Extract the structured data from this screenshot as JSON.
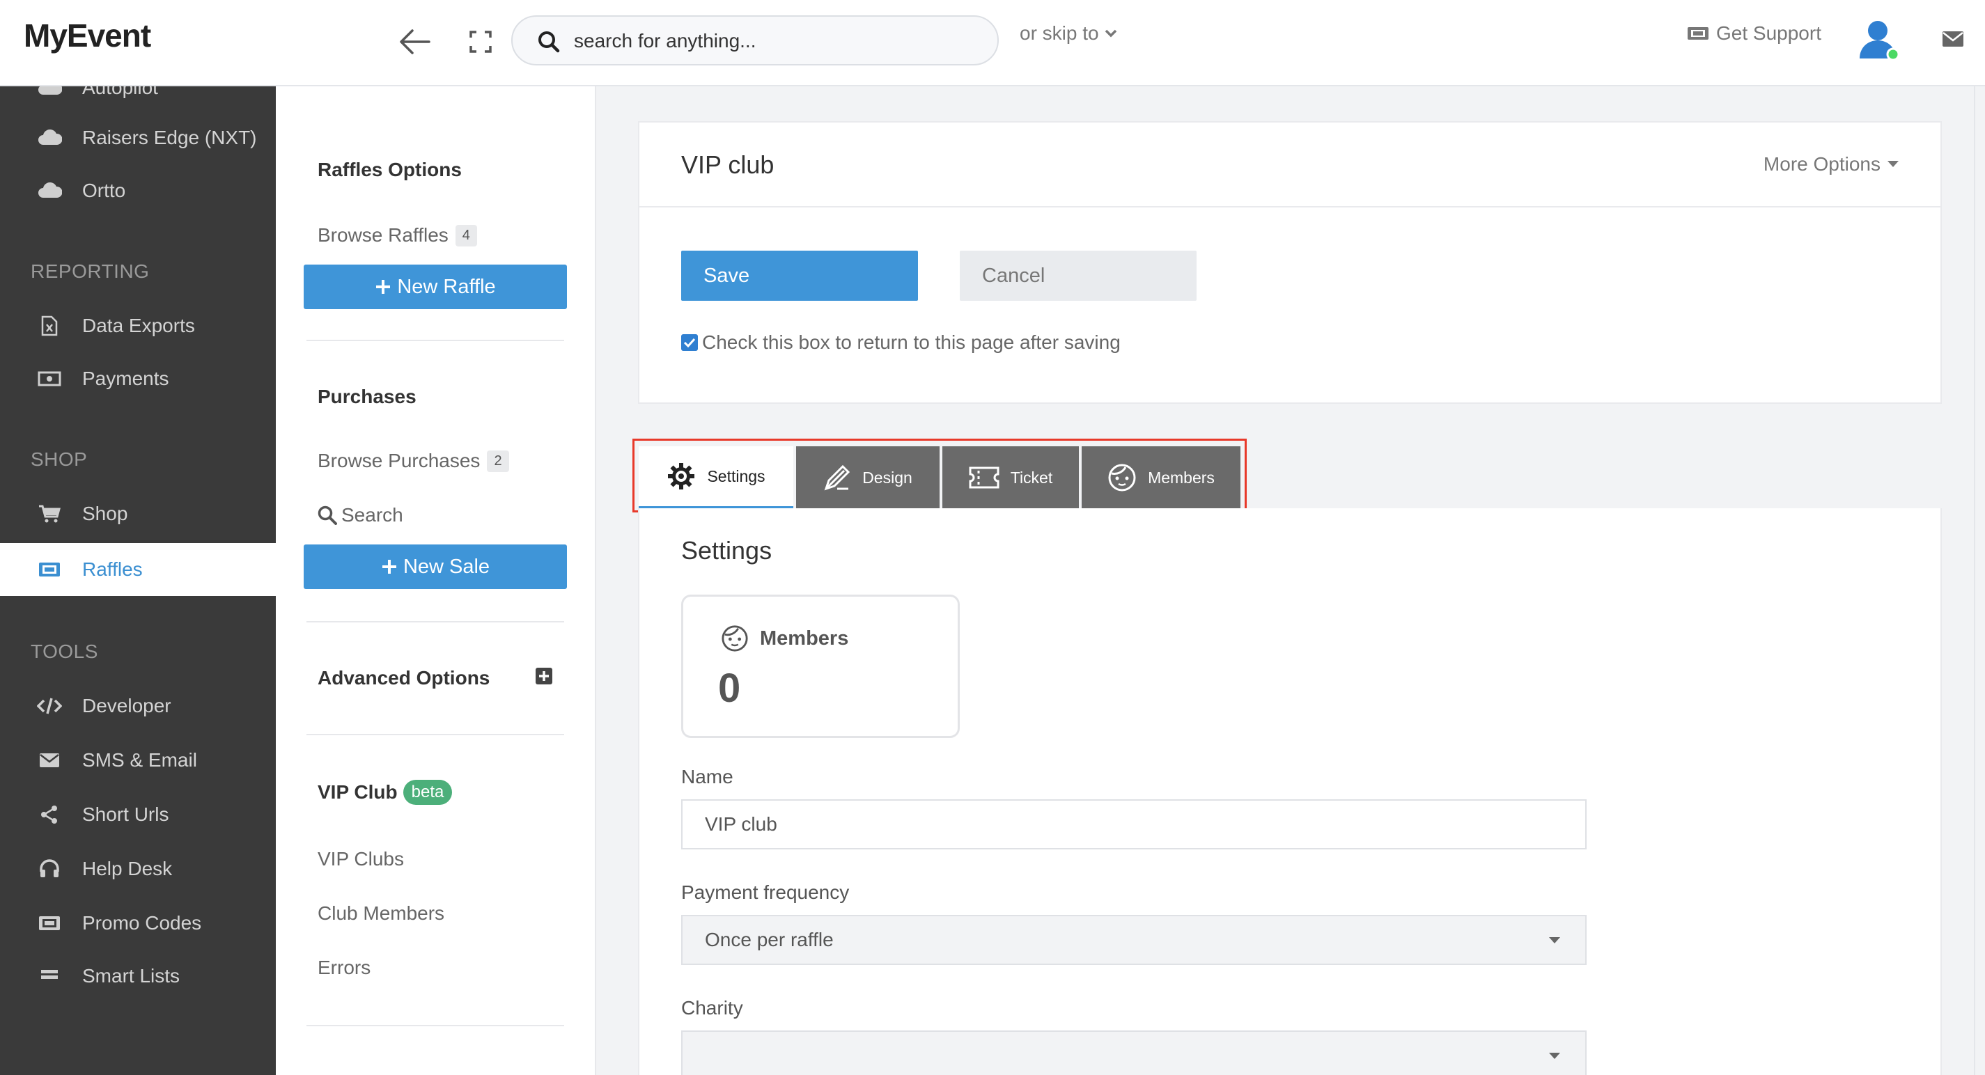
{
  "app": {
    "name": "MyEvent"
  },
  "topbar": {
    "search_placeholder": "search for anything...",
    "skip_label": "or skip to",
    "support_label": "Get Support"
  },
  "sidebar": {
    "items": [
      {
        "label": "Autopilot",
        "icon": "cloud-icon"
      },
      {
        "label": "Raisers Edge (NXT)",
        "icon": "cloud-icon"
      },
      {
        "label": "Ortto",
        "icon": "cloud-icon"
      },
      {
        "label": "Data Exports",
        "icon": "excel-file-icon"
      },
      {
        "label": "Payments",
        "icon": "money-icon"
      },
      {
        "label": "Shop",
        "icon": "cart-icon"
      },
      {
        "label": "Raffles",
        "icon": "ticket-icon"
      },
      {
        "label": "Developer",
        "icon": "code-icon"
      },
      {
        "label": "SMS & Email",
        "icon": "envelope-icon"
      },
      {
        "label": "Short Urls",
        "icon": "share-icon"
      },
      {
        "label": "Help Desk",
        "icon": "headset-icon"
      },
      {
        "label": "Promo Codes",
        "icon": "ticket-icon"
      },
      {
        "label": "Smart Lists",
        "icon": "list-icon"
      }
    ],
    "sections": {
      "reporting": "REPORTING",
      "shop": "SHOP",
      "tools": "TOOLS"
    },
    "active": "Raffles"
  },
  "subnav": {
    "raffles_options": "Raffles Options",
    "browse_raffles": "Browse Raffles",
    "browse_raffles_count": "4",
    "new_raffle": "New Raffle",
    "purchases": "Purchases",
    "browse_purchases": "Browse Purchases",
    "browse_purchases_count": "2",
    "search": "Search",
    "new_sale": "New Sale",
    "advanced_options": "Advanced Options",
    "vip_club": "VIP Club",
    "vip_badge": "beta",
    "vip_clubs": "VIP Clubs",
    "club_members": "Club Members",
    "errors": "Errors"
  },
  "header_panel": {
    "title": "VIP club",
    "more_options": "More Options",
    "save": "Save",
    "cancel": "Cancel",
    "return_checkbox_label": "Check this box to return to this page after saving",
    "return_checked": true
  },
  "tabs": [
    {
      "label": "Settings",
      "icon": "gear-icon",
      "active": true
    },
    {
      "label": "Design",
      "icon": "design-icon",
      "active": false
    },
    {
      "label": "Ticket",
      "icon": "ticket-icon",
      "active": false
    },
    {
      "label": "Members",
      "icon": "face-icon",
      "active": false
    }
  ],
  "settings": {
    "title": "Settings",
    "members_label": "Members",
    "members_count": "0",
    "name_label": "Name",
    "name_value": "VIP club",
    "payment_frequency_label": "Payment frequency",
    "payment_frequency_value": "Once per raffle",
    "charity_label": "Charity",
    "charity_value": ""
  },
  "colors": {
    "accent": "#3f95d8",
    "sidebar_bg": "#3a3a3a",
    "highlight_frame": "#e8392a",
    "badge_green": "#4caf7a",
    "online_dot": "#4cd964"
  }
}
